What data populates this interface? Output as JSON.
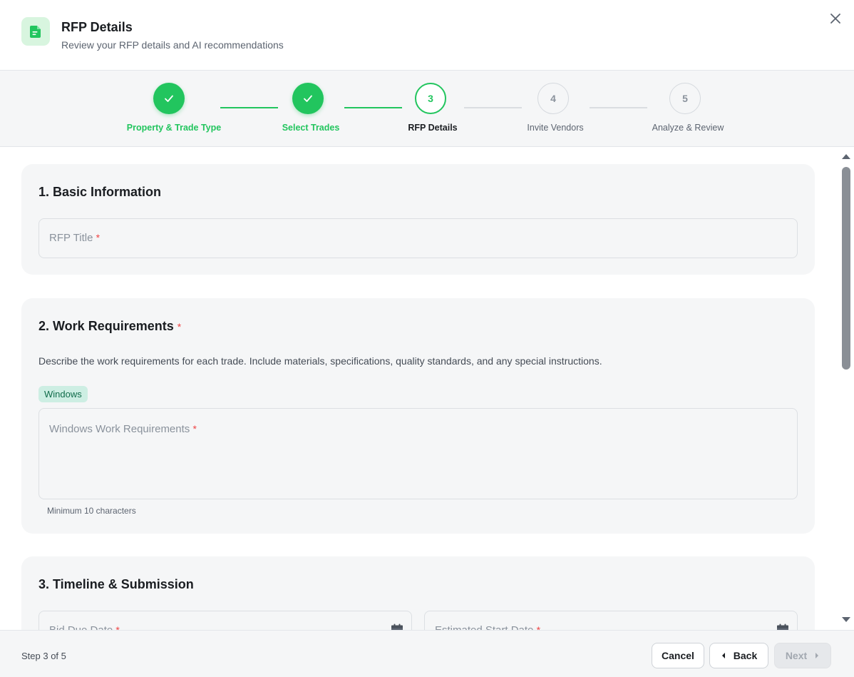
{
  "header": {
    "title": "RFP Details",
    "subtitle": "Review your RFP details and AI recommendations",
    "icon": "document-icon",
    "close_icon": "close-icon"
  },
  "stepper": {
    "steps": [
      {
        "number": "1",
        "label": "Property & Trade Type",
        "state": "done"
      },
      {
        "number": "2",
        "label": "Select Trades",
        "state": "done"
      },
      {
        "number": "3",
        "label": "RFP Details",
        "state": "active"
      },
      {
        "number": "4",
        "label": "Invite Vendors",
        "state": "todo"
      },
      {
        "number": "5",
        "label": "Analyze & Review",
        "state": "todo"
      }
    ]
  },
  "sections": {
    "basic": {
      "title": "1. Basic Information",
      "rfp_title_placeholder": "RFP Title",
      "required_mark": "*"
    },
    "work": {
      "title": "2. Work Requirements",
      "required_mark": "*",
      "description": "Describe the work requirements for each trade. Include materials, specifications, quality standards, and any special instructions.",
      "trade_chip": "Windows",
      "textarea_placeholder": "Windows Work Requirements",
      "helper": "Minimum 10 characters"
    },
    "timeline": {
      "title": "3. Timeline & Submission",
      "bid_due_placeholder": "Bid Due Date",
      "start_date_placeholder": "Estimated Start Date",
      "required_mark": "*"
    }
  },
  "footer": {
    "step_text": "Step 3 of 5",
    "cancel_label": "Cancel",
    "back_label": "Back",
    "next_label": "Next"
  },
  "colors": {
    "accent": "#22c55e",
    "required": "#ef4444",
    "chip_bg": "#cdeee3",
    "chip_text": "#106b4a"
  }
}
